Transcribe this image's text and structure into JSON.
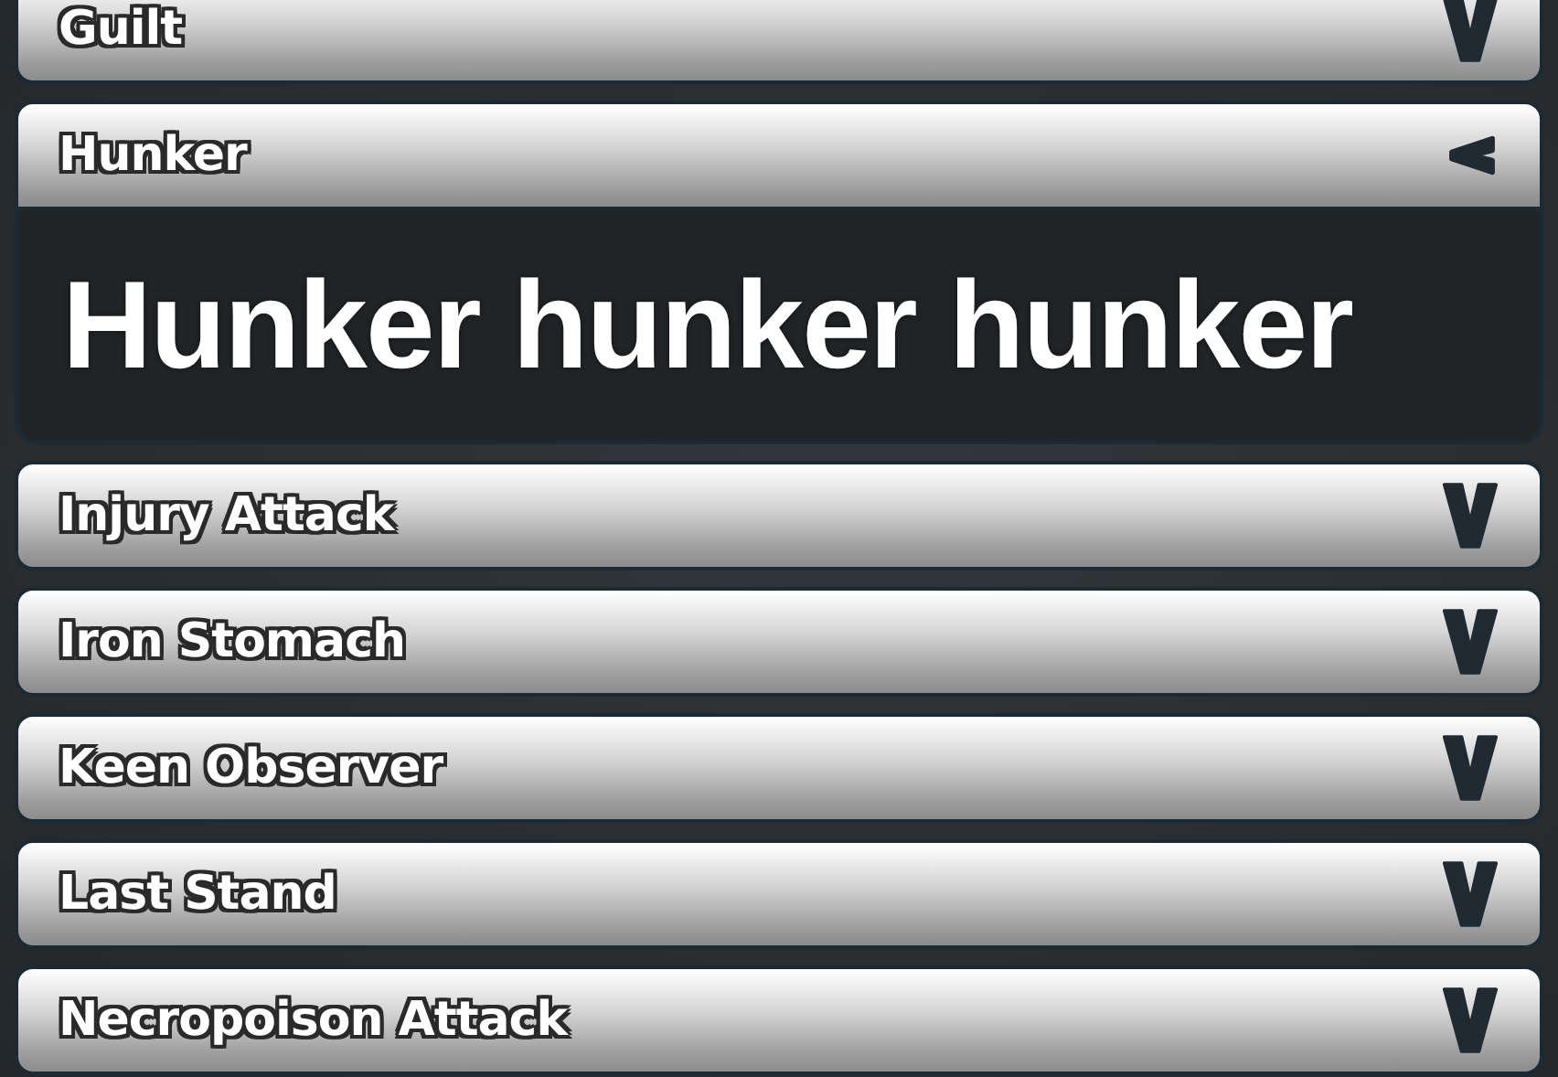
{
  "perks": [
    {
      "name": "Guilt",
      "expanded": false
    },
    {
      "name": "Hunker",
      "expanded": true,
      "description": "Hunker hunker hunker"
    },
    {
      "name": "Injury Attack",
      "expanded": false
    },
    {
      "name": "Iron Stomach",
      "expanded": false
    },
    {
      "name": "Keen Observer",
      "expanded": false
    },
    {
      "name": "Last Stand",
      "expanded": false
    },
    {
      "name": "Necropoison Attack",
      "expanded": false
    }
  ]
}
